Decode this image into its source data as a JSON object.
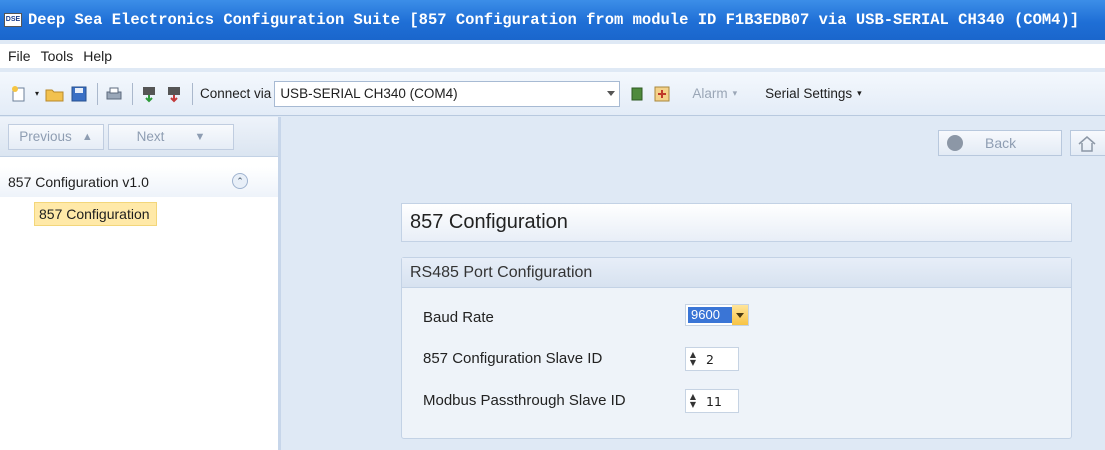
{
  "window": {
    "title": "Deep Sea Electronics Configuration Suite [857 Configuration from module ID F1B3EDB07 via USB-SERIAL CH340 (COM4)]",
    "app_icon_text": "DSE"
  },
  "menu": {
    "file": "File",
    "tools": "Tools",
    "help": "Help"
  },
  "toolbar": {
    "connect_label": "Connect via",
    "connection_value": "USB-SERIAL CH340 (COM4)",
    "alarm_label": "Alarm",
    "serial_settings_label": "Serial Settings",
    "icons": [
      "new-icon",
      "open-folder-icon",
      "save-icon",
      "print-icon",
      "read-from-module-icon",
      "write-to-module-icon",
      "module-status-icon",
      "diagnostics-icon"
    ]
  },
  "nav": {
    "previous_label": "Previous",
    "next_label": "Next",
    "back_label": "Back"
  },
  "tree": {
    "root_label": "857 Configuration v1.0",
    "items": [
      {
        "label": "857 Configuration",
        "selected": true
      }
    ]
  },
  "main": {
    "page_title": "857 Configuration",
    "section_title": "RS485 Port Configuration",
    "fields": {
      "baud_rate_label": "Baud Rate",
      "baud_rate_value": "9600",
      "slave_id_label": "857 Configuration Slave ID",
      "slave_id_value": "2",
      "passthrough_label": "Modbus Passthrough Slave ID",
      "passthrough_value": "11"
    }
  },
  "colors": {
    "titlebar": "#1f6fd6",
    "selection_highlight": "#ffe9a8",
    "baud_selected": "#3a75d6"
  }
}
